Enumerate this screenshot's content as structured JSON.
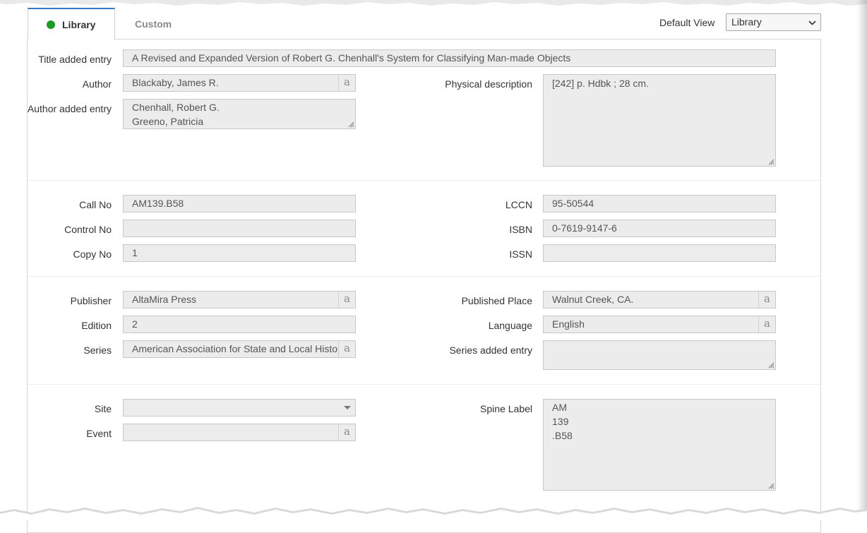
{
  "tabs": [
    {
      "label": "Library",
      "active": true
    },
    {
      "label": "Custom",
      "active": false
    }
  ],
  "default_view": {
    "label": "Default View",
    "selected": "Library"
  },
  "fields": {
    "title_added_entry": {
      "label": "Title added entry",
      "value": "A Revised and Expanded Version of Robert G. Chenhall's System for Classifying Man-made Objects"
    },
    "author": {
      "label": "Author",
      "value": "Blackaby, James R."
    },
    "author_added_entry": {
      "label": "Author added entry",
      "lines": [
        "Chenhall, Robert G.",
        "Greeno, Patricia"
      ]
    },
    "physical_description": {
      "label": "Physical description",
      "value": "[242] p. Hdbk  ; 28 cm."
    },
    "call_no": {
      "label": "Call No",
      "value": "AM139.B58"
    },
    "control_no": {
      "label": "Control No",
      "value": ""
    },
    "copy_no": {
      "label": "Copy No",
      "value": "1"
    },
    "lccn": {
      "label": "LCCN",
      "value": "95-50544"
    },
    "isbn": {
      "label": "ISBN",
      "value": "0-7619-9147-6"
    },
    "issn": {
      "label": "ISSN",
      "value": ""
    },
    "publisher": {
      "label": "Publisher",
      "value": "AltaMira Press"
    },
    "edition": {
      "label": "Edition",
      "value": "2"
    },
    "series": {
      "label": "Series",
      "value": "American Association for State and Local History"
    },
    "published_place": {
      "label": "Published Place",
      "value": "Walnut Creek, CA."
    },
    "language": {
      "label": "Language",
      "value": "English"
    },
    "series_added_entry": {
      "label": "Series added entry",
      "value": ""
    },
    "site": {
      "label": "Site",
      "value": ""
    },
    "event": {
      "label": "Event",
      "value": ""
    },
    "spine_label": {
      "label": "Spine Label",
      "lines": [
        "AM",
        "139",
        ".B58"
      ]
    }
  },
  "lookup_glyph": "a",
  "colors": {
    "active_dot": "#1e9b22",
    "active_tab_border": "#3477c7",
    "field_bg": "#ececec"
  }
}
